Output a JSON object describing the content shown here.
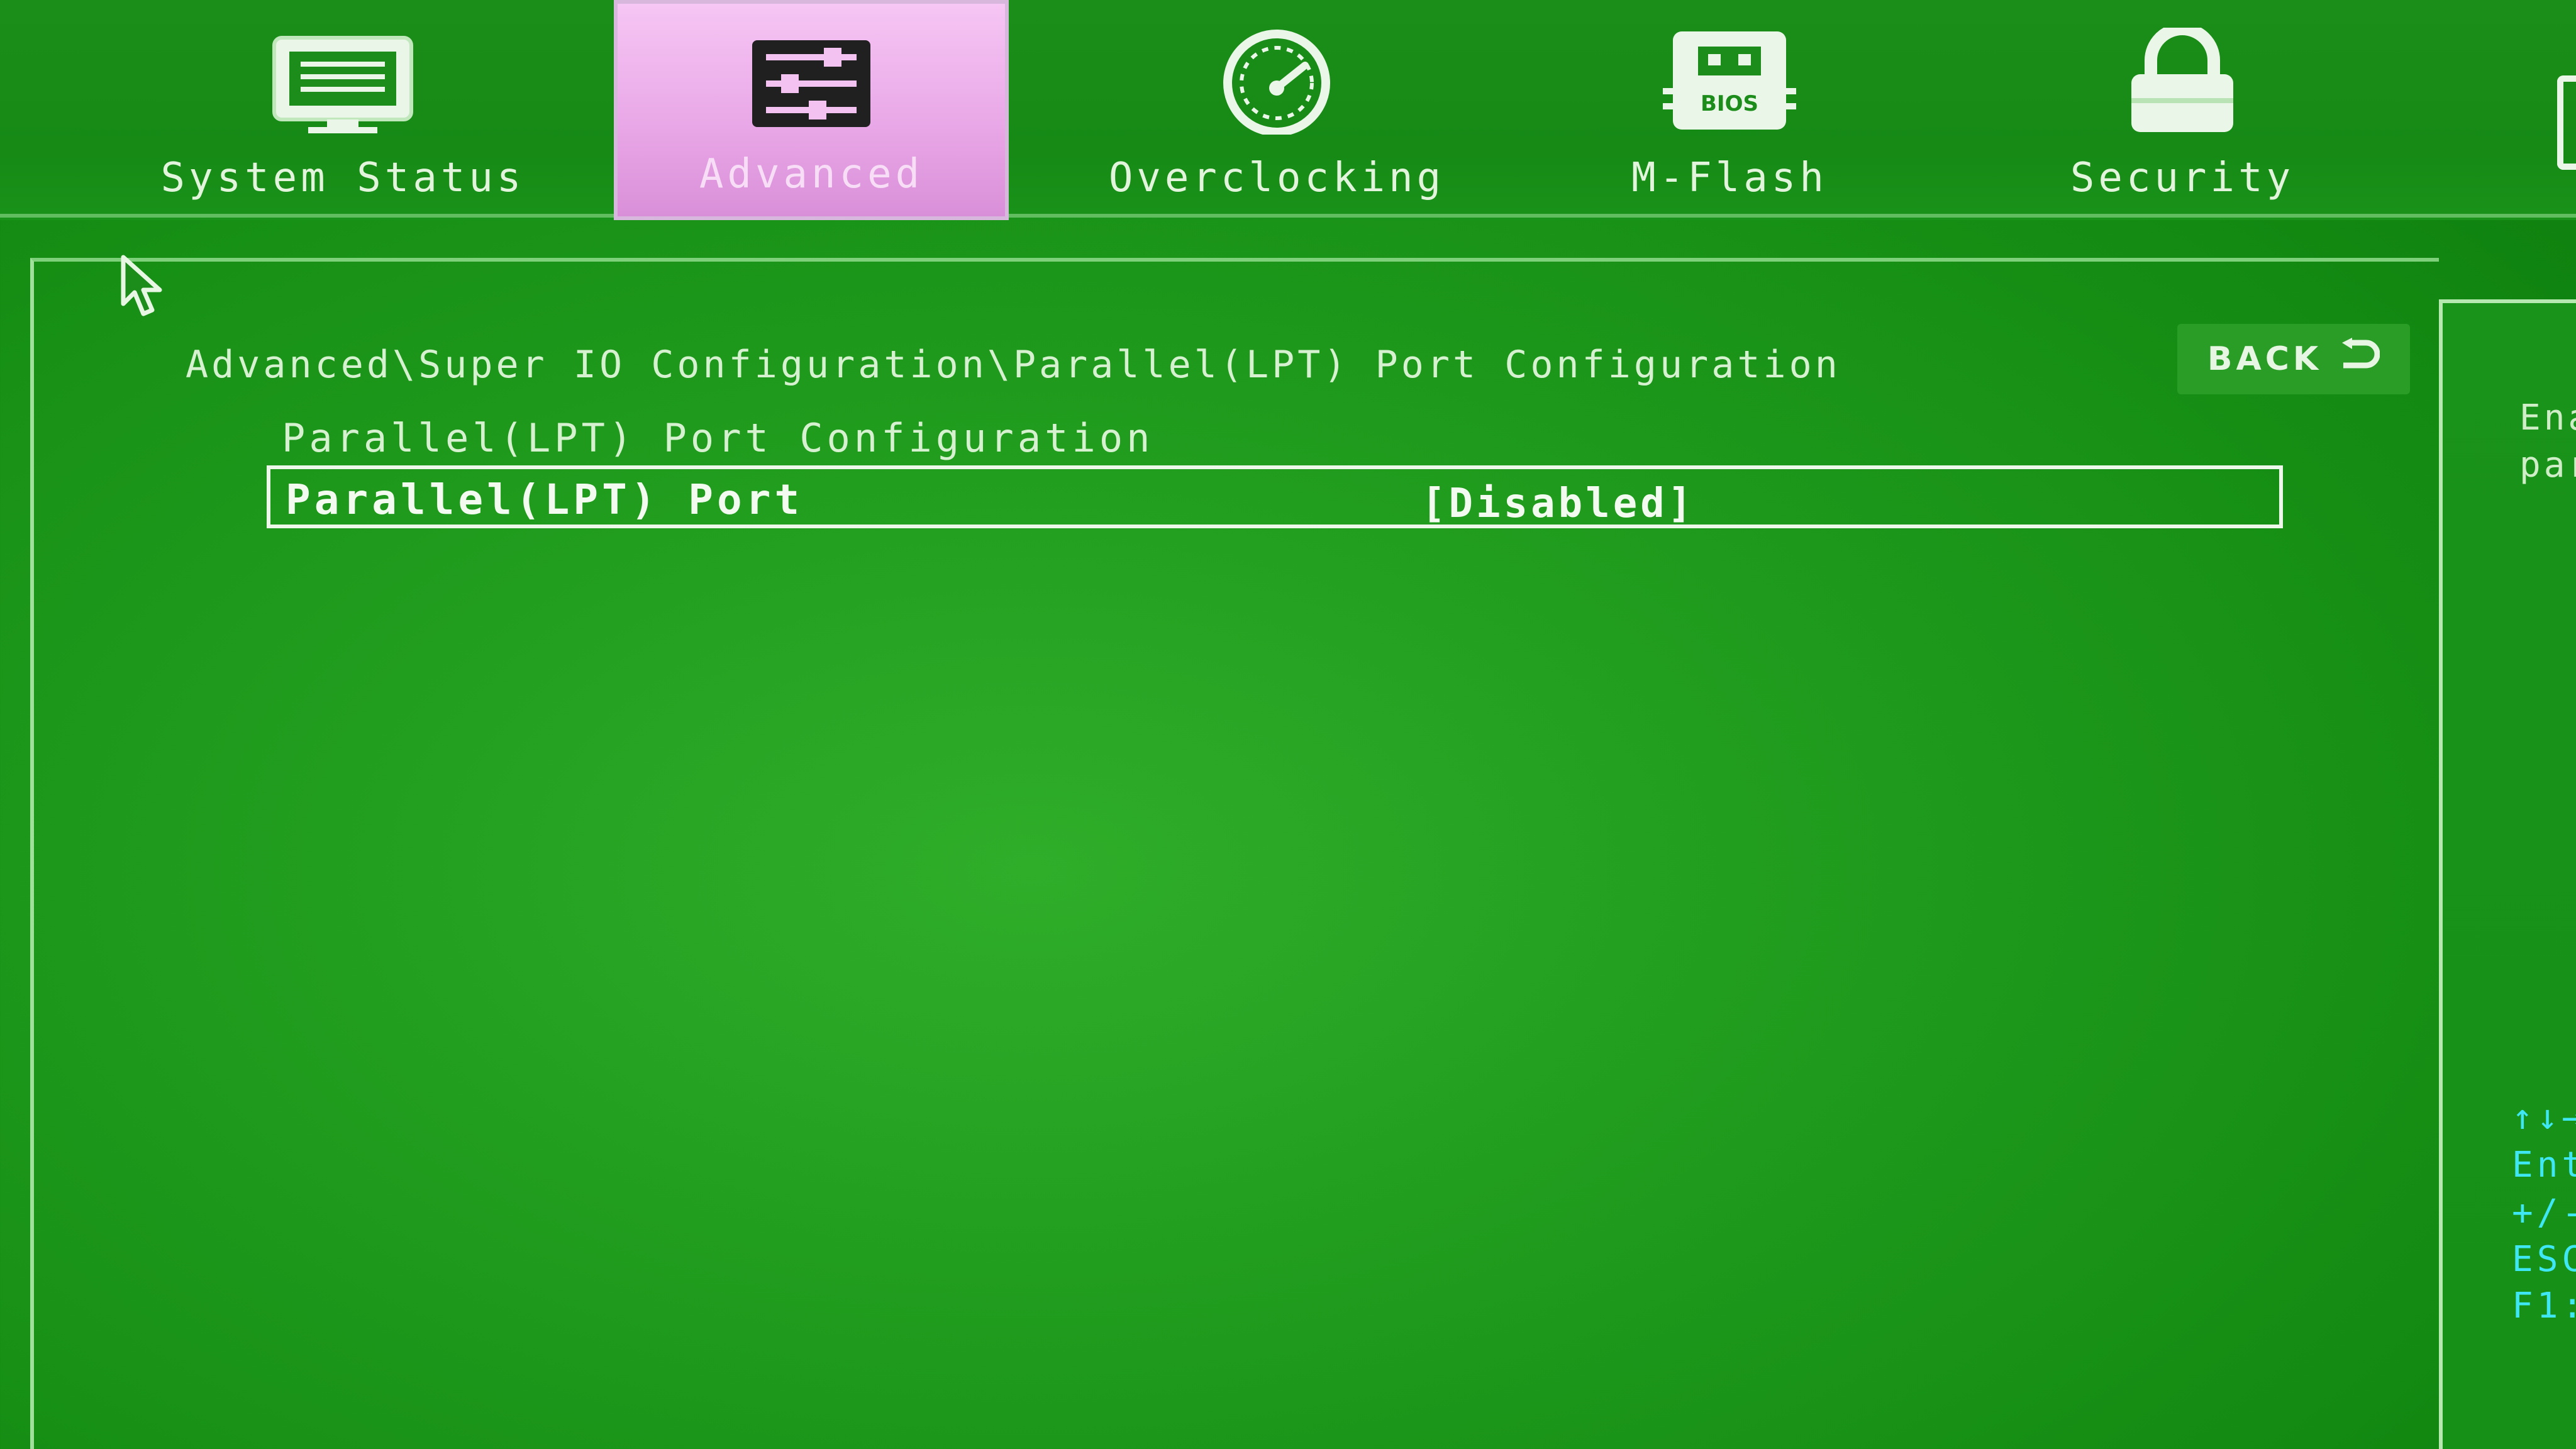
{
  "tabs": [
    {
      "label": "System Status",
      "icon": "monitor-icon"
    },
    {
      "label": "Advanced",
      "icon": "sliders-icon",
      "active": true
    },
    {
      "label": "Overclocking",
      "icon": "speedometer-icon"
    },
    {
      "label": "M-Flash",
      "icon": "bios-chip-icon"
    },
    {
      "label": "Security",
      "icon": "lock-icon"
    }
  ],
  "breadcrumb": "Advanced\\Super IO Configuration\\Parallel(LPT) Port Configuration",
  "back_button": {
    "label": "BACK",
    "icon": "return-arrow-icon"
  },
  "section_title": "Parallel(LPT) Port Configuration",
  "setting": {
    "name": "Parallel(LPT) Port",
    "value": "[Disabled]"
  },
  "help": {
    "lines": [
      "Ena",
      "par"
    ]
  },
  "key_legend": [
    "↑↓→",
    "Ent",
    "+/-",
    "ESC",
    "F1:"
  ],
  "colors": {
    "background": "#1f9a1c",
    "active_tab": "#e8a6e6",
    "key_legend": "#3fe6f3"
  }
}
